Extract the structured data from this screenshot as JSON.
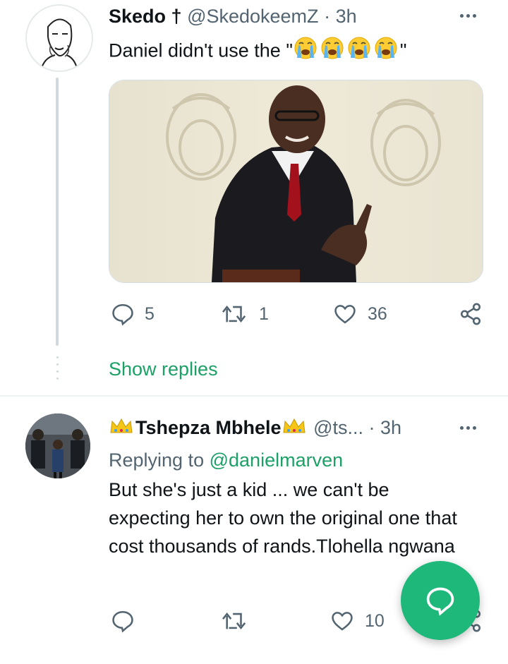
{
  "tweets": [
    {
      "display_name": "Skedo †",
      "handle": "@SkedokeemZ",
      "separator": "·",
      "time": "3h",
      "text": "Daniel didn't use the \"",
      "text_end": "\"",
      "emoji": "loudly-crying-face",
      "emoji_count": 4,
      "actions": {
        "reply": "5",
        "retweet": "1",
        "like": "36"
      },
      "show_replies": "Show replies"
    },
    {
      "display_name": "Tshepza Mbhele",
      "handle": "@ts...",
      "separator": "·",
      "time": "3h",
      "replying_to_label": "Replying to",
      "replying_to_handle": "@danielmarven",
      "text": "But she's just a kid ... we can't be expecting her to own the original one that cost thousands of rands.Tlohella ngwana",
      "actions": {
        "reply": "",
        "retweet": "",
        "like": "10"
      }
    }
  ],
  "colors": {
    "accent": "#1da067",
    "fab": "#1eb87a",
    "muted": "#536471",
    "crown": "#f5c518"
  },
  "fab_icon": "chat-bubble-icon"
}
